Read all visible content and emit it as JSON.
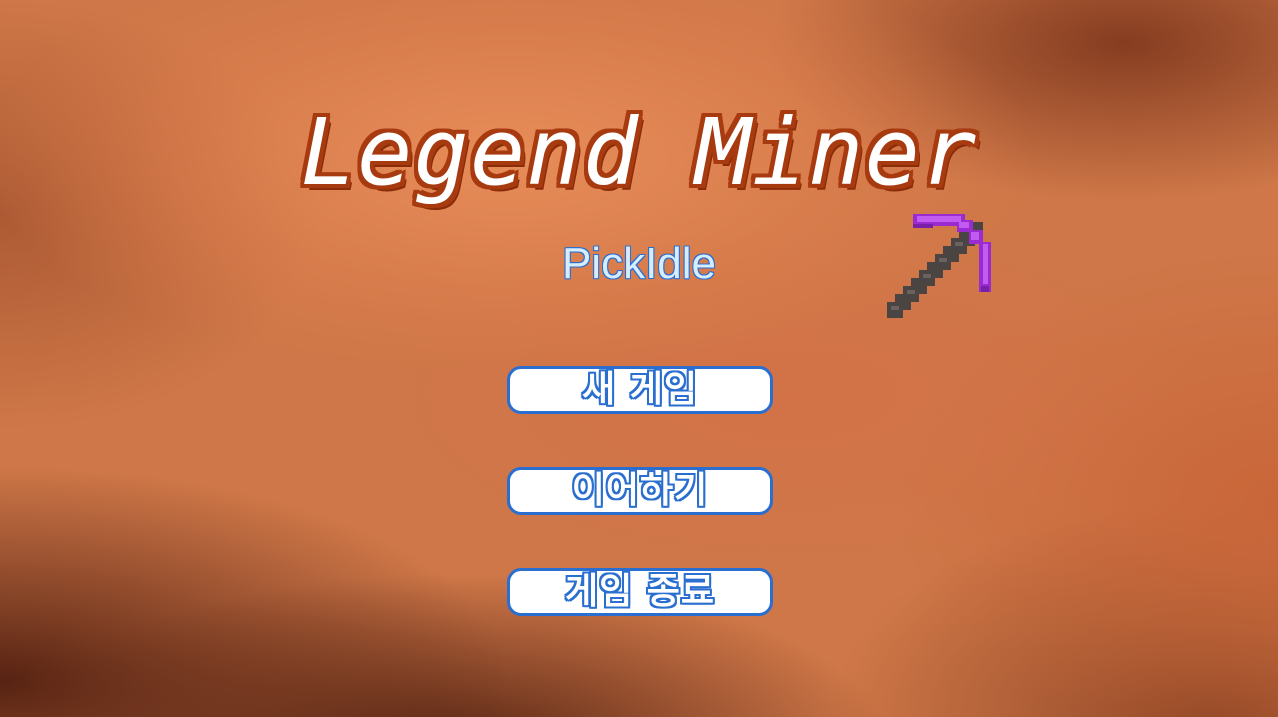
{
  "game": {
    "title": "Legend Miner",
    "subtitle": "PickIdle"
  },
  "menu": {
    "new_game": "새 게임",
    "continue": "이어하기",
    "quit": "게임 종료"
  },
  "icons": {
    "logo_icon": "pickaxe-icon"
  },
  "colors": {
    "title_outline": "#a83a10",
    "button_border": "#2a6fd0",
    "pickaxe_head": "#b13be6",
    "pickaxe_handle": "#4a4443"
  }
}
